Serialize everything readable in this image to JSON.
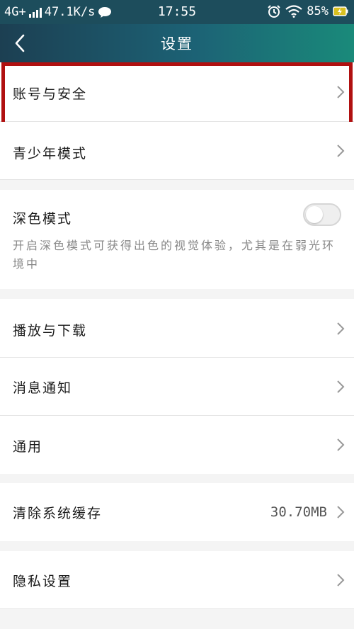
{
  "status_bar": {
    "network": "4G+",
    "speed": "47.1K/s",
    "time": "17:55",
    "battery": "85%"
  },
  "header": {
    "title": "设置"
  },
  "settings": {
    "account_security": "账号与安全",
    "teen_mode": "青少年模式",
    "dark_mode": {
      "label": "深色模式",
      "enabled": false,
      "description": "开启深色模式可获得出色的视觉体验，尤其是在弱光环境中"
    },
    "playback_download": "播放与下载",
    "notifications": "消息通知",
    "general": "通用",
    "clear_cache": {
      "label": "清除系统缓存",
      "value": "30.70MB"
    },
    "privacy": "隐私设置"
  },
  "colors": {
    "header_start": "#1c3f52",
    "header_end": "#1a8a7a",
    "highlight_border": "#b01010"
  }
}
